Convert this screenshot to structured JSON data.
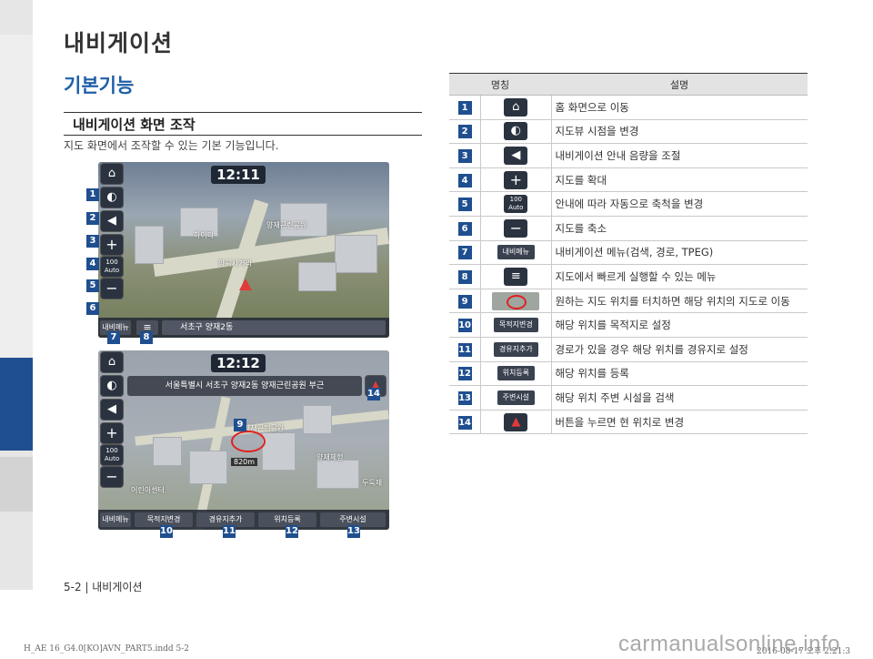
{
  "header": {
    "page_title": "내비게이션",
    "section_title": "기본기능",
    "subsection_title": "내비게이션 화면 조작",
    "description": "지도 화면에서 조작할 수 있는 기본 기능입니다."
  },
  "screen1": {
    "time": "12:11",
    "address": "서초구 양재2동",
    "menu_label": "내비메뉴",
    "places": [
      "양곡사거리",
      "하이디",
      "양재근린공원"
    ],
    "buttons": [
      "home",
      "compass",
      "volume",
      "zoom-in",
      "auto",
      "zoom-out"
    ],
    "auto_top": "100",
    "auto_label": "Auto"
  },
  "screen2": {
    "time": "12:12",
    "banner": "서울특별시 서초구 양재2동 양재근린공원 부근",
    "distance": "820m",
    "places": [
      "양재근린공원",
      "양재체험",
      "두둑재",
      "어린이센터"
    ],
    "bottom_buttons": [
      "내비메뉴",
      "목적지변경",
      "경유지추가",
      "위치등록",
      "주변시설"
    ],
    "auto_top": "100",
    "auto_label": "Auto"
  },
  "callouts": {
    "s1": [
      "1",
      "2",
      "3",
      "4",
      "5",
      "6",
      "7",
      "8"
    ],
    "s2": [
      "9",
      "10",
      "11",
      "12",
      "13",
      "14"
    ]
  },
  "table": {
    "col_name": "명칭",
    "col_desc": "설명",
    "rows": [
      {
        "no": "1",
        "icon": "home-icon",
        "desc": "홈 화면으로 이동"
      },
      {
        "no": "2",
        "icon": "compass-icon",
        "desc": "지도뷰 시점을 변경"
      },
      {
        "no": "3",
        "icon": "volume-icon",
        "desc": "내비게이션 안내 음량을 조절"
      },
      {
        "no": "4",
        "icon": "zoom-in-icon",
        "desc": "지도를 확대"
      },
      {
        "no": "5",
        "icon": "auto-icon",
        "desc": "안내에 따라 자동으로 축척을 변경"
      },
      {
        "no": "6",
        "icon": "zoom-out-icon",
        "desc": "지도를 축소"
      },
      {
        "no": "7",
        "label": "내비메뉴",
        "desc": "내비게이션 메뉴(검색, 경로, TPEG)"
      },
      {
        "no": "8",
        "icon": "quick-menu-icon",
        "desc": "지도에서 빠르게 실행할 수 있는 메뉴"
      },
      {
        "no": "9",
        "icon": "map-touch-icon",
        "desc": "원하는 지도 위치를 터치하면 해당 위치의 지도로 이동"
      },
      {
        "no": "10",
        "label": "목적지변경",
        "desc": "해당 위치를 목적지로 설정"
      },
      {
        "no": "11",
        "label": "경유지추가",
        "desc": "경로가 있을 경우 해당 위치를 경유지로 설정"
      },
      {
        "no": "12",
        "label": "위치등록",
        "desc": "해당 위치를 등록"
      },
      {
        "no": "13",
        "label": "주변시설",
        "desc": "해당 위치 주변 시설을 검색"
      },
      {
        "no": "14",
        "icon": "current-location-icon",
        "desc": "버튼을 누르면 현 위치로 변경"
      }
    ]
  },
  "footer": {
    "page_ref": "5-2 | 내비게이션",
    "print_left": "H_AE 16_G4.0[KO]AVN_PART5.indd   5-2",
    "print_right": "2016-08-17   오후 2:21:3",
    "watermark": "carmanualsonline.info"
  },
  "colors": {
    "accent": "#1f4f8f",
    "section_title": "#1f5fa8",
    "callout_circle": "#e02020"
  }
}
